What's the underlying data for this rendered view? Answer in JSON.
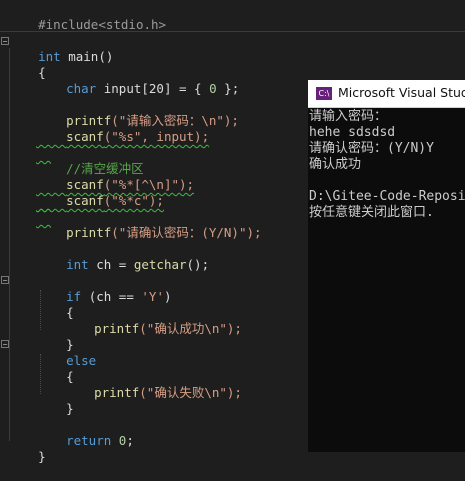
{
  "editor": {
    "lines": {
      "include": "#include<stdio.h>",
      "main_kw": "int",
      "main_rest": " main()",
      "open_brace": "{",
      "l_char_kw": "char",
      "l_char_rest": " input[20] = { ",
      "l_char_num": "0",
      "l_char_end": " };",
      "printf1_fn": "printf",
      "printf1_arg": "(\"请输入密码：\\n\");",
      "scanf1_fn": "scanf",
      "scanf1_arg": "(\"%s\", input);",
      "comment": "//清空缓冲区",
      "scanf2_fn": "scanf",
      "scanf2_arg": "(\"%*[^\\n]\");",
      "scanf3_fn": "scanf",
      "scanf3_arg": "(\"%*c\");",
      "printf2_fn": "printf",
      "printf2_arg": "(\"请确认密码：(Y/N)\");",
      "ch_kw": "int",
      "ch_rest": " ch = ",
      "ch_fn": "getchar",
      "ch_end": "();",
      "if_kw": "if",
      "if_rest": " (ch == ",
      "if_str": "'Y'",
      "if_end": ")",
      "if_open": "{",
      "printf3_fn": "printf",
      "printf3_arg": "(\"确认成功\\n\");",
      "if_close": "}",
      "else_kw": "else",
      "else_open": "{",
      "printf4_fn": "printf",
      "printf4_arg": "(\"确认失败\\n\");",
      "else_close": "}",
      "return_kw": "return",
      "return_num": " 0",
      "return_end": ";",
      "close_brace": "}"
    },
    "fold_symbol": "−"
  },
  "console": {
    "icon_text": "C:\\",
    "title": "Microsoft Visual Studio",
    "output": [
      "请输入密码：",
      "hehe sdsdsd",
      "请确认密码：(Y/N)Y",
      "确认成功",
      "",
      "D:\\Gitee-Code-Reposi",
      "按任意键关闭此窗口."
    ]
  },
  "colors": {
    "background": "#1e1e1e",
    "keyword": "#569cd6",
    "function": "#dcdcaa",
    "string": "#d69d85",
    "comment": "#57a64a",
    "console_bg": "#0c0c0c"
  }
}
